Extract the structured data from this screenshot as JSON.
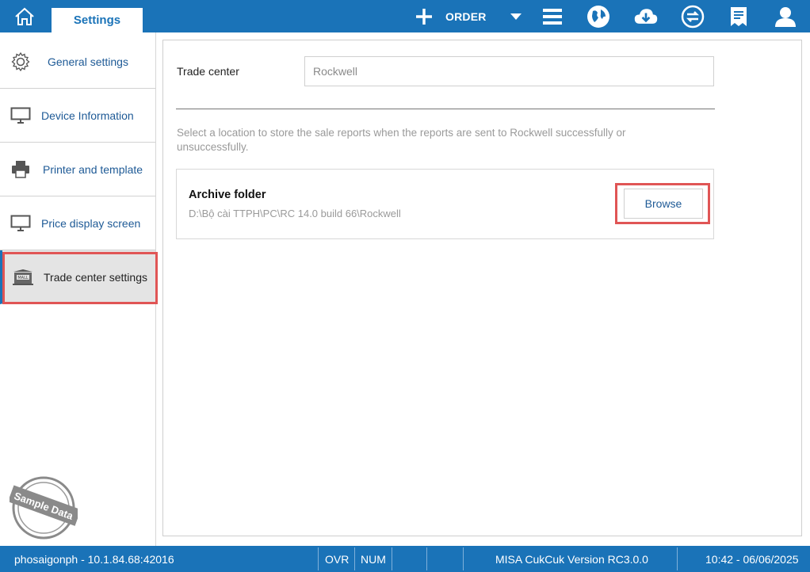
{
  "header": {
    "settings_tab": "Settings",
    "order_label": "ORDER",
    "icons": [
      "home-icon",
      "plus-icon",
      "caret-down-icon",
      "menu-icon",
      "globe-icon",
      "cloud-download-icon",
      "sync-icon",
      "receipt-icon",
      "user-icon"
    ]
  },
  "sidebar": {
    "items": [
      {
        "label": "General settings",
        "icon": "gear-icon"
      },
      {
        "label": "Device Information",
        "icon": "monitor-icon"
      },
      {
        "label": "Printer and template",
        "icon": "printer-icon"
      },
      {
        "label": "Price display screen",
        "icon": "monitor-icon"
      },
      {
        "label": "Trade center settings",
        "icon": "mall-icon"
      }
    ],
    "stamp": "Sample Data"
  },
  "main": {
    "trade_center_label": "Trade center",
    "trade_center_value": "Rockwell",
    "description": "Select a location to store the sale reports when the reports are sent to Rockwell successfully or unsuccessfully.",
    "archive_title": "Archive folder",
    "archive_path": "D:\\Bộ cài TTPH\\PC\\RC 14.0 build 66\\Rockwell",
    "browse_label": "Browse"
  },
  "status": {
    "connection": "phosaigonph - 10.1.84.68:42016",
    "ovr": "OVR",
    "num": "NUM",
    "version": "MISA CukCuk Version RC3.0.0",
    "datetime": "10:42 - 06/06/2025"
  },
  "colors": {
    "accent": "#1a73b8",
    "highlight": "#e05555"
  }
}
